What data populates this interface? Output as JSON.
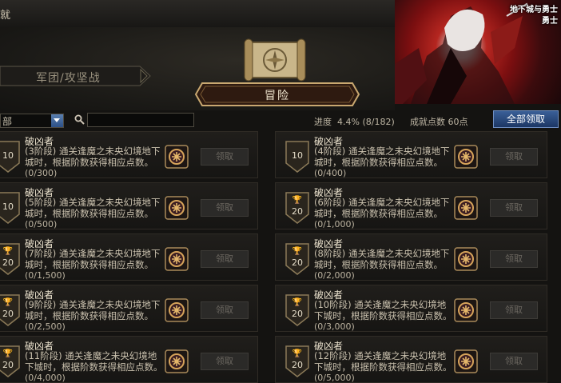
{
  "window": {
    "title": "就"
  },
  "tabs": {
    "legion": "军团/攻坚战",
    "adventure": "冒险"
  },
  "banner": {
    "logo_line1": "地下城与勇士",
    "logo_line2": "勇士"
  },
  "filter": {
    "dropdown_value": "部",
    "search_value": ""
  },
  "progress": {
    "label": "进度",
    "percent": "4.4%",
    "count": "(8/182)"
  },
  "points": {
    "text": "成就点数 60点"
  },
  "claim_all_label": "全部领取",
  "cards": [
    {
      "title": "破凶者",
      "desc": "(3阶段) 通关逢魔之未央幻境地下城时，根据阶数获得相应点数。",
      "count": "(0/300)",
      "points": "10",
      "trophy": false,
      "claim": "领取"
    },
    {
      "title": "破凶者",
      "desc": "(4阶段) 通关逢魔之未央幻境地下城时，根据阶数获得相应点数。",
      "count": "(0/400)",
      "points": "10",
      "trophy": false,
      "claim": "领取"
    },
    {
      "title": "破凶者",
      "desc": "(5阶段) 通关逢魔之未央幻境地下城时，根据阶数获得相应点数。",
      "count": "(0/500)",
      "points": "10",
      "trophy": false,
      "claim": "领取"
    },
    {
      "title": "破凶者",
      "desc": "(6阶段) 通关逢魔之未央幻境地下城时，根据阶数获得相应点数。",
      "count": "(0/1,000)",
      "points": "20",
      "trophy": true,
      "claim": "领取"
    },
    {
      "title": "破凶者",
      "desc": "(7阶段) 通关逢魔之未央幻境地下城时，根据阶数获得相应点数。",
      "count": "(0/1,500)",
      "points": "20",
      "trophy": true,
      "claim": "领取"
    },
    {
      "title": "破凶者",
      "desc": "(8阶段) 通关逢魔之未央幻境地下城时，根据阶数获得相应点数。",
      "count": "(0/2,000)",
      "points": "20",
      "trophy": true,
      "claim": "领取"
    },
    {
      "title": "破凶者",
      "desc": "(9阶段) 通关逢魔之未央幻境地下城时，根据阶数获得相应点数。",
      "count": "(0/2,500)",
      "points": "20",
      "trophy": true,
      "claim": "领取"
    },
    {
      "title": "破凶者",
      "desc": "(10阶段) 通关逢魔之未央幻境地下城时，根据阶数获得相应点数。",
      "count": "(0/3,000)",
      "points": "20",
      "trophy": true,
      "claim": "领取"
    },
    {
      "title": "破凶者",
      "desc": "(11阶段) 通关逢魔之未央幻境地下城时，根据阶数获得相应点数。",
      "count": "(0/4,000)",
      "points": "20",
      "trophy": true,
      "claim": "领取"
    },
    {
      "title": "破凶者",
      "desc": "(12阶段) 通关逢魔之未央幻境地下城时，根据阶数获得相应点数。",
      "count": "(0/5,000)",
      "points": "20",
      "trophy": true,
      "claim": "领取"
    }
  ]
}
